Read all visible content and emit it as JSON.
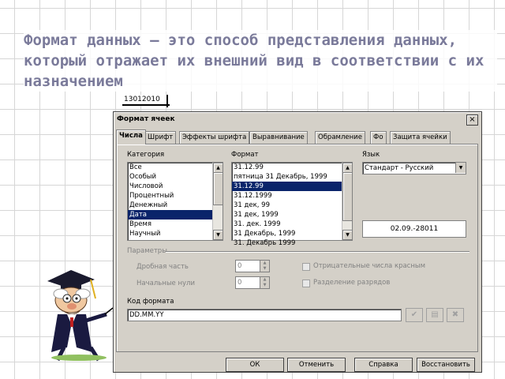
{
  "slide": {
    "title": "Формат данных – это способ представления данных, который отражает их внешний вид в соответствии с их назначением",
    "cell_value": "13012010"
  },
  "dialog": {
    "title": "Формат ячеек",
    "close": "×",
    "tabs": [
      "Числа",
      "Шрифт",
      "Эффекты шрифта",
      "Выравнивание",
      "Обрамление",
      "Фо",
      "Защита ячейки"
    ],
    "category_label": "Категория",
    "categories": [
      "Все",
      "Особый",
      "Числовой",
      "Процентный",
      "Денежный",
      "Дата",
      "Время",
      "Научный"
    ],
    "selected_category": "Дата",
    "format_label": "Формат",
    "formats": [
      "31.12.99",
      "пятница 31 Декабрь, 1999",
      "31.12.99",
      "31.12.1999",
      "31 дек, 99",
      "31 дек, 1999",
      "31. дек. 1999",
      "31 Декабрь, 1999",
      "31. Декабрь 1999"
    ],
    "selected_format_index": 2,
    "language_label": "Язык",
    "language_value": "Стандарт - Русский",
    "preview": "02.09.-28011",
    "params_label": "Параметры",
    "decimal_label": "Дробная часть",
    "decimal_value": "0",
    "leading_zeros_label": "Начальные нули",
    "leading_zeros_value": "0",
    "negative_red_label": "Отрицательные числа красным",
    "thousands_sep_label": "Разделение разрядов",
    "format_code_label": "Код формата",
    "format_code_value": "DD.MM.YY",
    "buttons": {
      "ok": "ОК",
      "cancel": "Отменить",
      "help": "Справка",
      "reset": "Восстановить"
    }
  },
  "icons": {
    "accept": "check-icon",
    "edit": "edit-comment-icon",
    "delete": "delete-icon"
  }
}
